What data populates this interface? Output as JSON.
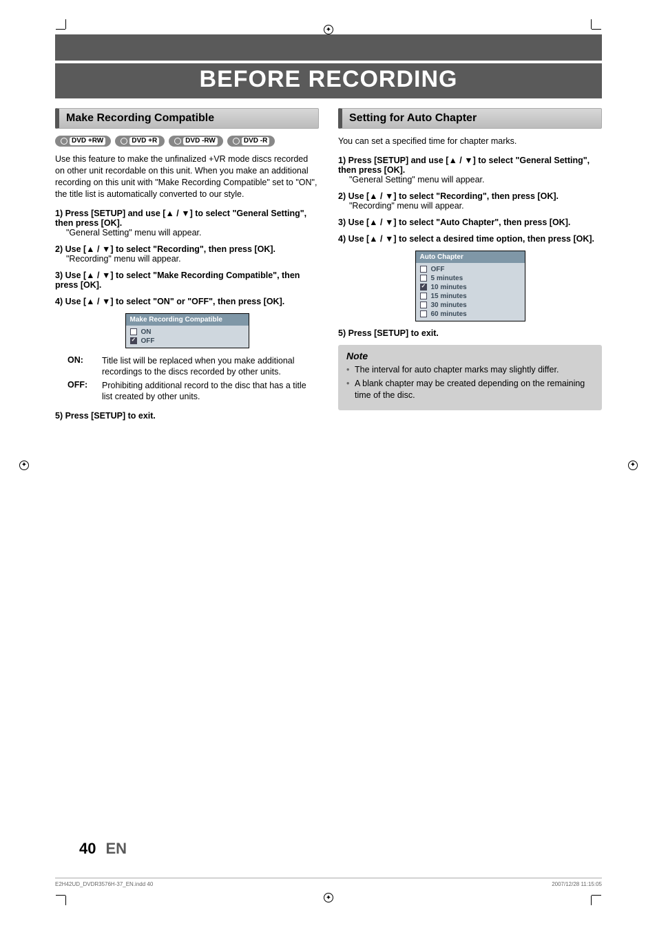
{
  "chapter_title": "BEFORE RECORDING",
  "left": {
    "section_title": "Make Recording Compatible",
    "disc_badges": [
      "DVD +RW",
      "DVD +R",
      "DVD -RW",
      "DVD -R"
    ],
    "intro": "Use this feature to make the unfinalized +VR mode discs recorded on other unit recordable on this unit. When you make an additional recording on this unit with \"Make Recording Compatible\" set to \"ON\", the title list is automatically converted to our style.",
    "steps": {
      "s1": "1) Press [SETUP] and use [▲ / ▼] to select \"General Setting\", then press [OK].",
      "s1_sub": "\"General Setting\" menu will appear.",
      "s2": "2) Use [▲ / ▼] to select \"Recording\", then press [OK].",
      "s2_sub": "\"Recording\" menu will appear.",
      "s3": "3) Use [▲ / ▼] to select \"Make Recording Compatible\", then press [OK].",
      "s4": "4) Use [▲ / ▼] to select \"ON\" or \"OFF\", then press [OK].",
      "s5": "5) Press [SETUP] to exit."
    },
    "ui": {
      "title": "Make Recording Compatible",
      "options": [
        {
          "label": "ON",
          "checked": false
        },
        {
          "label": "OFF",
          "checked": true
        }
      ]
    },
    "defs": [
      {
        "term": "ON:",
        "desc": "Title list will be replaced when you make additional recordings to the discs recorded by other units."
      },
      {
        "term": "OFF:",
        "desc": "Prohibiting additional record to the disc that has a title list created by other units."
      }
    ]
  },
  "right": {
    "section_title": "Setting for Auto Chapter",
    "intro": "You can set a specified time for chapter marks.",
    "steps": {
      "s1": "1) Press [SETUP] and use [▲ / ▼] to select \"General Setting\", then press [OK].",
      "s1_sub": "\"General Setting\" menu will appear.",
      "s2": "2) Use [▲ / ▼] to select \"Recording\", then press [OK].",
      "s2_sub": "\"Recording\" menu will appear.",
      "s3": "3) Use [▲ / ▼] to select \"Auto Chapter\", then press [OK].",
      "s4": "4) Use [▲ / ▼] to select a desired time option, then press [OK].",
      "s5": "5) Press [SETUP] to exit."
    },
    "ui": {
      "title": "Auto Chapter",
      "options": [
        {
          "label": "OFF",
          "checked": false
        },
        {
          "label": "5 minutes",
          "checked": false
        },
        {
          "label": "10 minutes",
          "checked": true
        },
        {
          "label": "15 minutes",
          "checked": false
        },
        {
          "label": "30 minutes",
          "checked": false
        },
        {
          "label": "60 minutes",
          "checked": false
        }
      ]
    },
    "note_title": "Note",
    "notes": [
      "The interval for auto chapter marks may slightly differ.",
      "A blank chapter may be created depending on the remaining time of the disc."
    ]
  },
  "page_number": "40",
  "page_lang": "EN",
  "footer_left": "E2H42UD_DVDR3576H-37_EN.indd   40",
  "footer_right": "2007/12/28   11:15:05"
}
